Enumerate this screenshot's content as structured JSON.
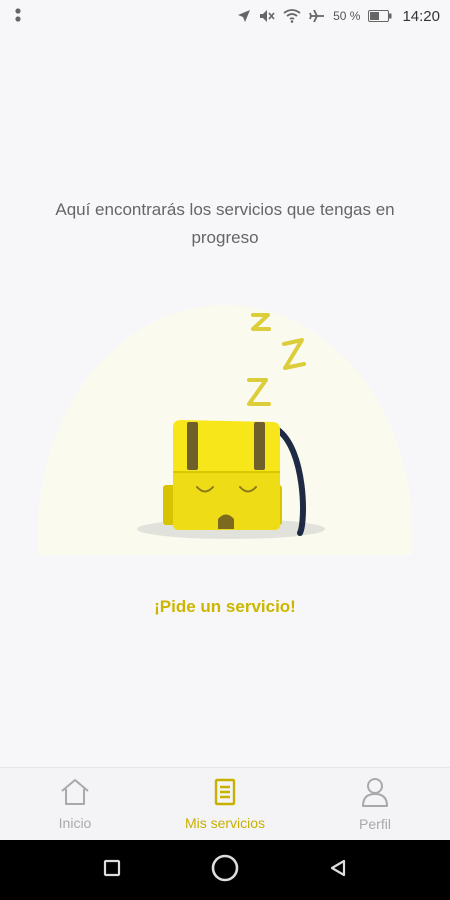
{
  "status_bar": {
    "battery_percent": "50 %",
    "time": "14:20",
    "icons": [
      "menu-dots-icon",
      "location-arrow-icon",
      "mute-icon",
      "wifi-icon",
      "airplane-icon",
      "battery-icon"
    ]
  },
  "main": {
    "message": "Aquí encontrarás los servicios que tengas en progreso",
    "illustration": "sleeping-backpack",
    "cta_label": "¡Pide un servicio!"
  },
  "bottom_nav": {
    "items": [
      {
        "label": "Inicio",
        "icon": "home-icon",
        "active": false
      },
      {
        "label": "Mis servicios",
        "icon": "document-icon",
        "active": true
      },
      {
        "label": "Perfil",
        "icon": "person-icon",
        "active": false
      }
    ]
  },
  "android_nav": [
    "recent-apps-button",
    "home-button",
    "back-button"
  ],
  "colors": {
    "accent": "#c7b000",
    "background": "#f7f7f9",
    "nav_inactive": "#a9a9ad",
    "backpack_yellow": "#f5e000"
  }
}
